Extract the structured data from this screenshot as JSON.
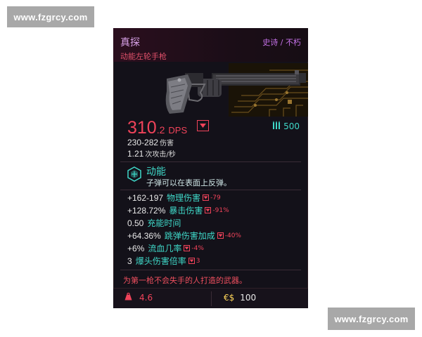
{
  "watermark": {
    "top": "www.fzgrcy.com",
    "bottom": "www.fzgrcy.com"
  },
  "item": {
    "name": "真探",
    "rarity": "史诗 / 不朽",
    "type": "动能左轮手枪",
    "dps_int": "310",
    "dps_dec": ".2",
    "dps_label": "DPS",
    "ammo": "500",
    "damage_value": "230-282",
    "damage_unit": "伤害",
    "attack_speed_value": "1.21",
    "attack_speed_unit": "次攻击/秒",
    "mod_name": "动能",
    "mod_desc": "子弹可以在表面上反弹。",
    "stats": [
      {
        "value": "+162-197",
        "label": "物理伤害",
        "delta": "-79"
      },
      {
        "value": "+128.72%",
        "label": "暴击伤害",
        "delta": "-91%"
      },
      {
        "value": "0.50",
        "label": "充能时间",
        "delta": ""
      },
      {
        "value": "+64.36%",
        "label": "跳弹伤害加成",
        "delta": "-40%"
      },
      {
        "value": "+6%",
        "label": "流血几率",
        "delta": "-4%"
      },
      {
        "value": "3",
        "label": "爆头伤害倍率",
        "delta": "3"
      }
    ],
    "flavor": "为第一枪不会失手的人打造的武器。",
    "weight": "4.6",
    "price_symbol": "€$",
    "price": "100",
    "icons": {
      "compare": "compare-down-icon",
      "ammo": "ammo-icon",
      "mod": "kinetic-mod-icon",
      "weight": "weight-icon"
    },
    "colors": {
      "accent_red": "#f0435a",
      "accent_teal": "#3fd8c8",
      "rarity_purple": "#c571e8",
      "price_gold": "#ffd65a"
    }
  }
}
